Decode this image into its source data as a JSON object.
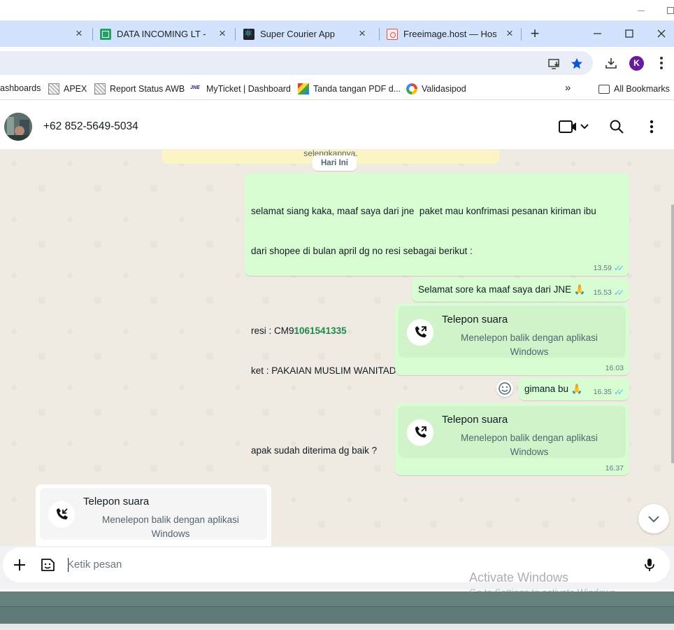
{
  "browser": {
    "tabs": [
      {
        "title": "DATA INCOMING LT - Go",
        "favicon": "sheets-icon"
      },
      {
        "title": "Super Courier App",
        "favicon": "react-icon"
      },
      {
        "title": "Freeimage.host — Hostin",
        "favicon": "freeimage-icon"
      }
    ],
    "profile_initial": "K",
    "bookmarks": [
      {
        "label": "ashboards",
        "icon": "dashboard-icon"
      },
      {
        "label": "APEX",
        "icon": "page-icon"
      },
      {
        "label": "Report Status AWB",
        "icon": "page-icon"
      },
      {
        "label": "MyTicket | Dashboard",
        "icon": "jne-icon"
      },
      {
        "label": "Tanda tangan PDF d...",
        "icon": "pdf-sign-icon"
      },
      {
        "label": "Validasipod",
        "icon": "validasi-icon"
      }
    ],
    "more_bookmarks": "»",
    "all_bookmarks": "All Bookmarks"
  },
  "chat": {
    "contact": "+62 852-5649-5034",
    "truncated_system_text": "selengkapnya.",
    "day_chip": "Hari Ini",
    "messages": {
      "m1": {
        "line1": "selamat siang kaka, maaf saya dari jne  paket mau konfrimasi pesanan kiriman ibu",
        "line2": "dari shopee di bulan april dg no resi sebagai berikut :",
        "resi_prefix": "resi : CM9",
        "resi_number": "1061541335",
        "ket": "ket : PAKAIAN MUSLIM WANITADRESSABAYA,PAKAIAN MUSLIM WANITADRESSAB",
        "line_last": "apak sudah diterima dg baik ?",
        "time": "13.59"
      },
      "m2": {
        "text": "Selamat sore ka maaf saya dari JNE 🙏",
        "time": "15.53"
      },
      "m3": {
        "title": "Telepon suara",
        "subtitle": "Menelepon balik dengan aplikasi Windows",
        "time": "16.03"
      },
      "m4": {
        "text": "gimana bu 🙏",
        "time": "16.35"
      },
      "m5": {
        "title": "Telepon suara",
        "subtitle": "Menelepon balik dengan aplikasi Windows",
        "time": "16.37"
      },
      "m6": {
        "title": "Telepon suara",
        "subtitle": "Menelepon balik dengan aplikasi Windows"
      }
    },
    "composer_placeholder": "Ketik pesan"
  },
  "watermark": {
    "line1": "Activate Windows",
    "line2": "Go to Settings to activate Windows."
  },
  "colors": {
    "tabstrip": "#d3e3fd",
    "outgoing_bubble": "#d9fdd3",
    "chat_bg": "#efeae2",
    "read_ticks": "#53bdeb"
  }
}
